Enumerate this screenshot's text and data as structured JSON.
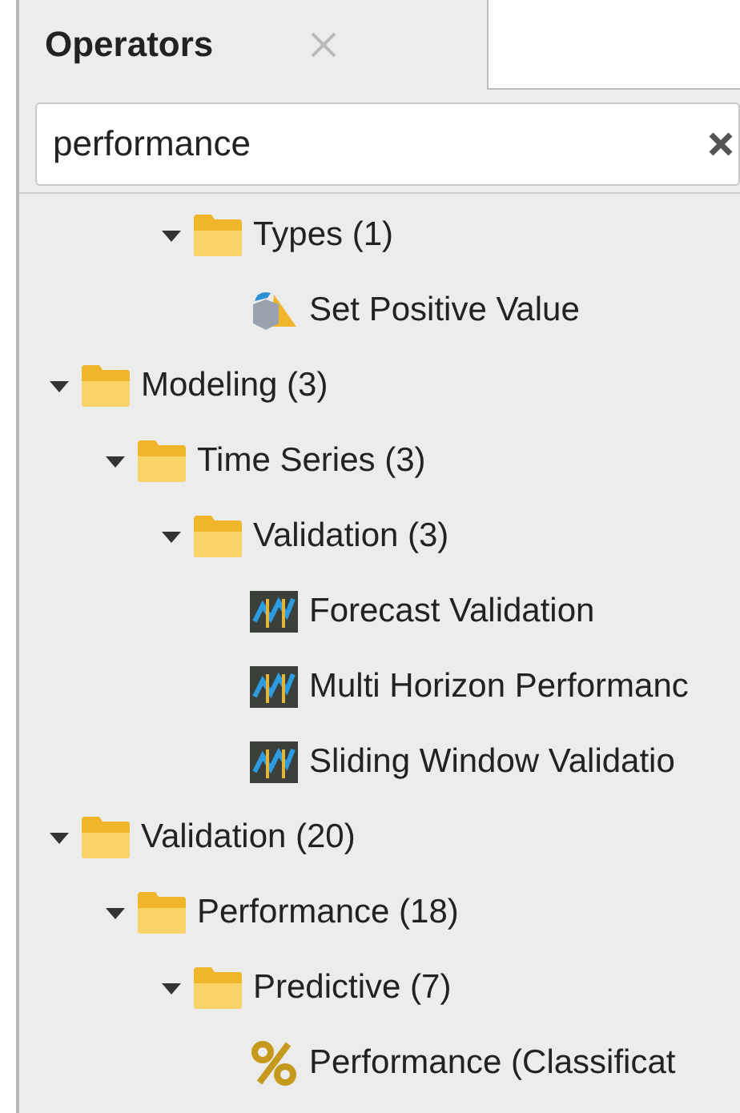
{
  "tab": {
    "label": "Operators",
    "selected": true
  },
  "search": {
    "value": "performance"
  },
  "tree": {
    "partial_branch": {
      "label": "Types (1)",
      "expanded": true,
      "children": [
        {
          "label": "Set Positive Value",
          "kind": "cube"
        }
      ]
    },
    "items": [
      {
        "label": "Modeling (3)",
        "expanded": true,
        "children": [
          {
            "label": "Time Series (3)",
            "expanded": true,
            "children": [
              {
                "label": "Validation (3)",
                "expanded": true,
                "children": [
                  {
                    "label": "Forecast Validation",
                    "kind": "series"
                  },
                  {
                    "label": "Multi Horizon Performanc",
                    "kind": "series"
                  },
                  {
                    "label": "Sliding Window Validatio",
                    "kind": "series"
                  }
                ]
              }
            ]
          }
        ]
      },
      {
        "label": "Validation (20)",
        "expanded": true,
        "children": [
          {
            "label": "Performance (18)",
            "expanded": true,
            "children": [
              {
                "label": "Predictive (7)",
                "expanded": true,
                "children": [
                  {
                    "label": "Performance (Classificat",
                    "kind": "percent"
                  }
                ]
              }
            ]
          }
        ]
      }
    ]
  }
}
